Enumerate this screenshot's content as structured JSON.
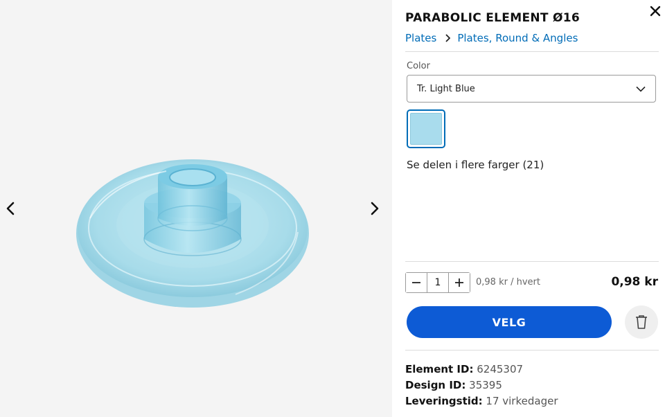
{
  "product": {
    "title": "PARABOLIC ELEMENT Ø16"
  },
  "breadcrumb": {
    "category": "Plates",
    "subcategory": "Plates, Round & Angles"
  },
  "color": {
    "label": "Color",
    "selected": "Tr. Light Blue",
    "swatch_hex": "#a9dced",
    "more_colors_text": "Se delen i flere farger (21)"
  },
  "purchase": {
    "quantity": "1",
    "unit_price": "0,98 kr / hvert",
    "total_price": "0,98 kr",
    "select_button": "VELG"
  },
  "details": [
    {
      "key": "Element ID:",
      "value": "6245307"
    },
    {
      "key": "Design ID:",
      "value": "35395"
    },
    {
      "key": "Leveringstid:",
      "value": "17 virkedager"
    }
  ],
  "icons": {
    "close": "close-icon",
    "prev": "chevron-left-icon",
    "next": "chevron-right-icon",
    "dropdown": "chevron-down-icon",
    "minus": "minus-icon",
    "plus": "plus-icon",
    "delete": "trash-icon"
  },
  "colors": {
    "accent": "#0d5bd5",
    "link": "#006cb7",
    "viewer_bg": "#f4f4f4"
  }
}
